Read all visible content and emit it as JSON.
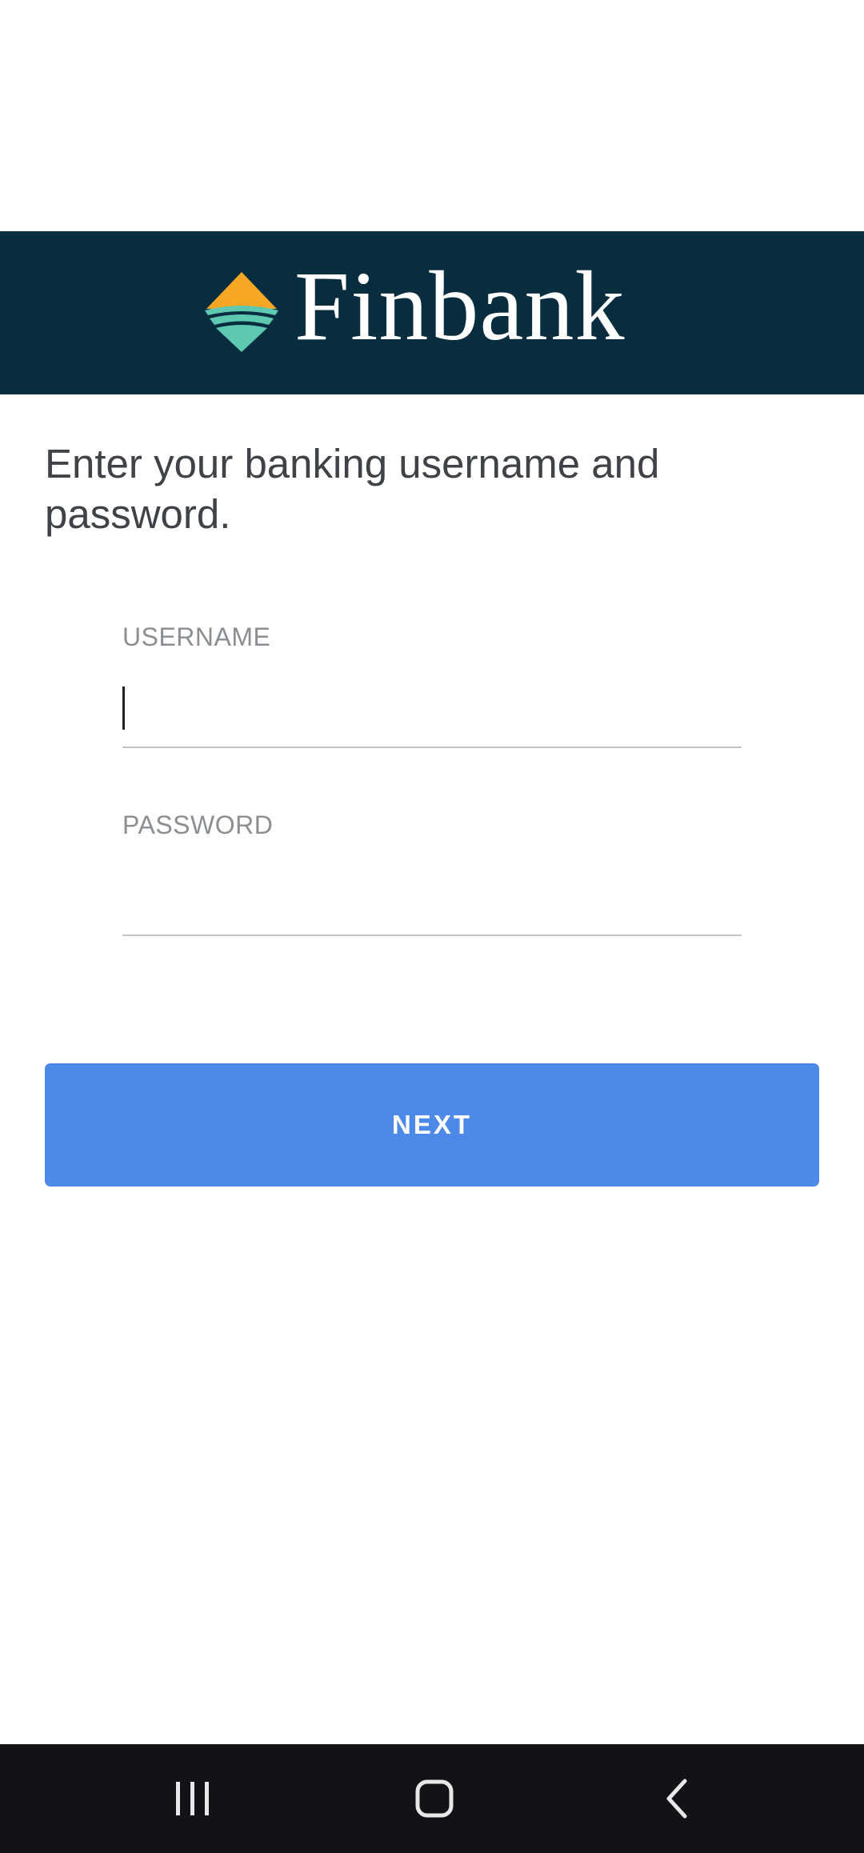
{
  "brand": {
    "name": "Finbank",
    "logo_icon": "finbank-diamond-logo-icon",
    "bar_color": "#072d3f",
    "logo_orange": "#f5a623",
    "logo_teal": "#5fc8b0"
  },
  "login": {
    "instructions": "Enter your banking username and password.",
    "username_label": "USERNAME",
    "username_value": "",
    "password_label": "PASSWORD",
    "password_value": "",
    "next_label": "NEXT",
    "button_color": "#4c89e9"
  },
  "system_nav": {
    "recents_icon": "recents-icon",
    "home_icon": "home-icon",
    "back_icon": "back-icon"
  }
}
